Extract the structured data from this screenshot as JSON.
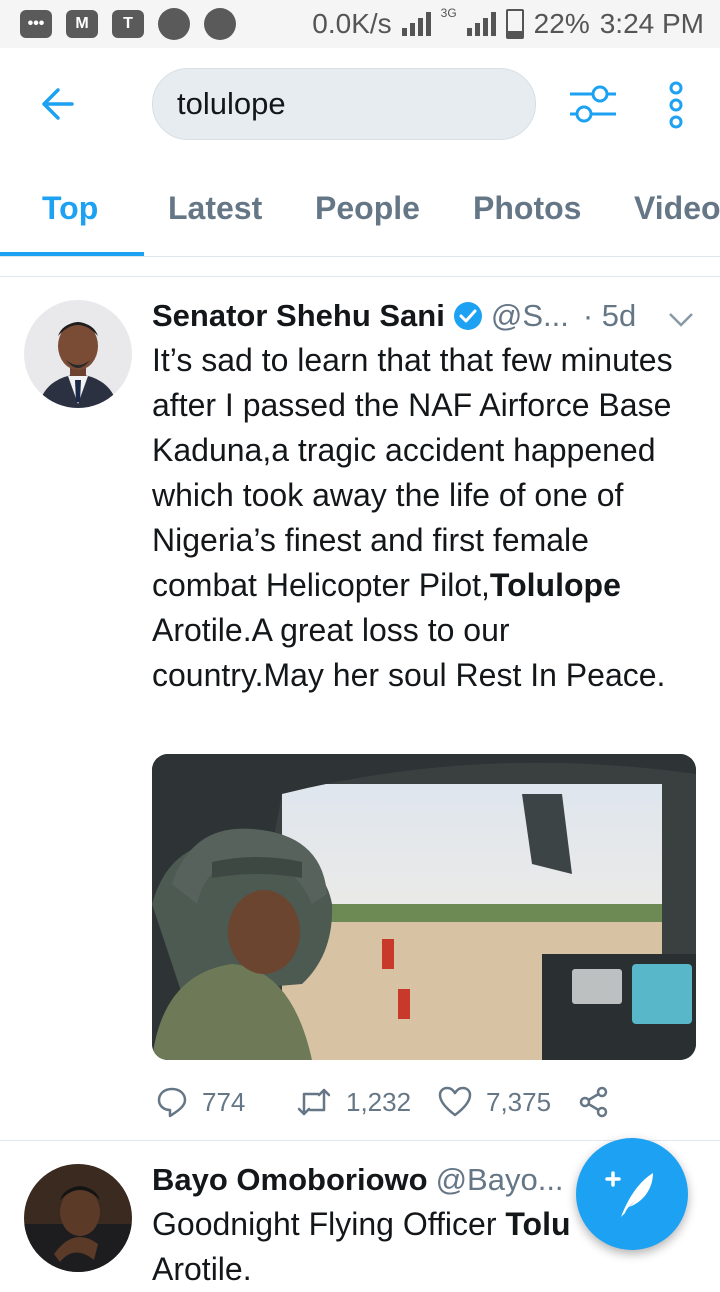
{
  "status_bar": {
    "speed": "0.0K/s",
    "network": "3G",
    "battery": "22%",
    "time": "3:24 PM"
  },
  "search": {
    "query": "tolulope"
  },
  "tabs": [
    {
      "label": "Top"
    },
    {
      "label": "Latest"
    },
    {
      "label": "People"
    },
    {
      "label": "Photos"
    },
    {
      "label": "Video"
    }
  ],
  "tweets": [
    {
      "name": "Senator Shehu Sani",
      "handle": "@S...",
      "time": "· 5d",
      "text_1": "It’s sad to learn that that few minutes after I passed the NAF Airforce Base Kaduna,a tragic accident happened which took away the life of one of Nigeria’s finest and first female combat Helicopter Pilot,",
      "text_bold": "Tolulope",
      "text_2": " Arotile.A great loss to our country.May her soul Rest In Peace.",
      "replies": "774",
      "retweets": "1,232",
      "likes": "7,375"
    },
    {
      "name": "Bayo Omoboriowo",
      "handle": "@Bayo...",
      "text_1": "Goodnight Flying Officer ",
      "text_bold": "Tolu",
      "text_2": "Arotile."
    }
  ],
  "colors": {
    "accent": "#1da1f2",
    "secondary_text": "#657786"
  }
}
